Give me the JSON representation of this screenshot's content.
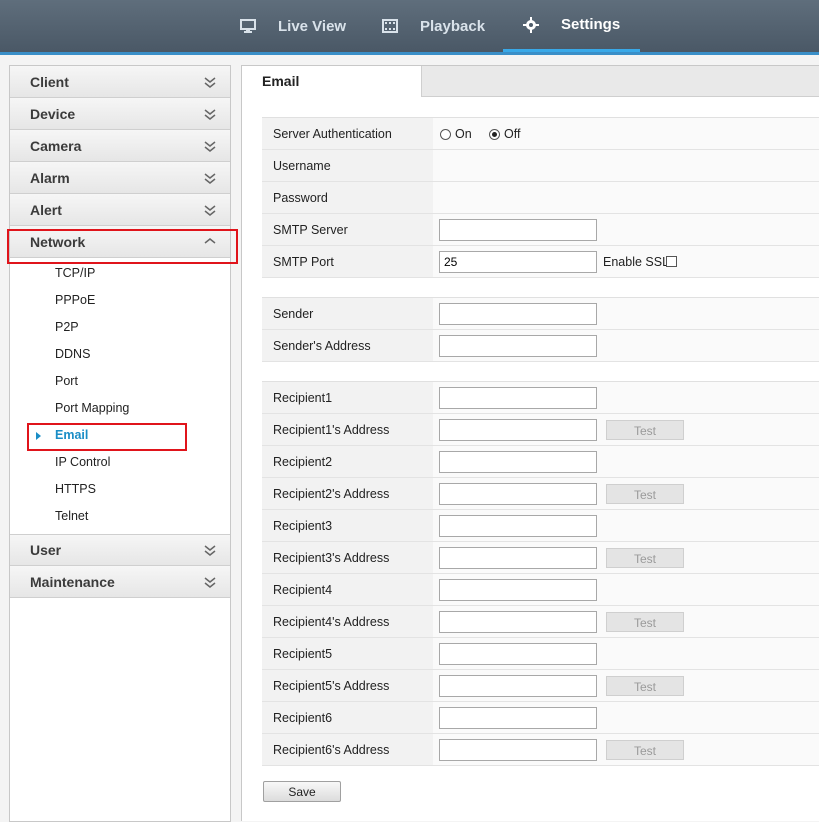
{
  "topnav": {
    "live_view": "Live View",
    "playback": "Playback",
    "settings": "Settings",
    "active": "Settings",
    "accent_color": "#39a9e8"
  },
  "sidebar": {
    "groups_top": [
      "Client",
      "Device",
      "Camera",
      "Alarm",
      "Alert"
    ],
    "network": "Network",
    "network_items": [
      "TCP/IP",
      "PPPoE",
      "P2P",
      "DDNS",
      "Port",
      "Port Mapping",
      "Email",
      "IP Control",
      "HTTPS",
      "Telnet"
    ],
    "active_item": "Email",
    "groups_bottom": [
      "User",
      "Maintenance"
    ],
    "active_color": "#1a8dc6",
    "highlight_color": "#e0141b"
  },
  "page": {
    "tab": "Email"
  },
  "auth": {
    "server_auth_label": "Server Authentication",
    "on_label": "On",
    "off_label": "Off",
    "selected": "Off",
    "username_label": "Username",
    "password_label": "Password",
    "smtp_server_label": "SMTP Server",
    "smtp_server_value": "",
    "smtp_port_label": "SMTP Port",
    "smtp_port_value": "25",
    "enable_ssl_label": "Enable SSL",
    "enable_ssl_checked": false
  },
  "sender": {
    "sender_label": "Sender",
    "sender_value": "",
    "address_label": "Sender's Address",
    "address_value": ""
  },
  "recipients": {
    "test_label": "Test",
    "items": [
      {
        "name_label": "Recipient1",
        "addr_label": "Recipient1's Address"
      },
      {
        "name_label": "Recipient2",
        "addr_label": "Recipient2's Address"
      },
      {
        "name_label": "Recipient3",
        "addr_label": "Recipient3's Address"
      },
      {
        "name_label": "Recipient4",
        "addr_label": "Recipient4's Address"
      },
      {
        "name_label": "Recipient5",
        "addr_label": "Recipient5's Address"
      },
      {
        "name_label": "Recipient6",
        "addr_label": "Recipient6's Address"
      }
    ]
  },
  "save_label": "Save"
}
